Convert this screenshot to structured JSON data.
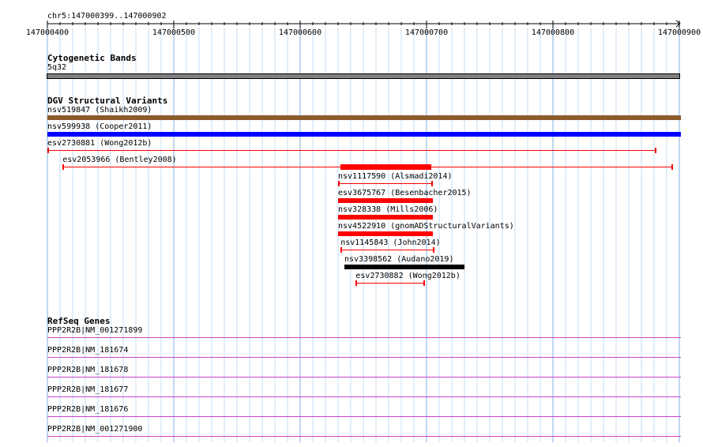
{
  "ruler": {
    "position": "chr5:147000399..147000902",
    "start": 147000400,
    "end": 147000900,
    "tick_labels": [
      "147000400",
      "147000500",
      "147000600",
      "147000700",
      "147000800",
      "147000900"
    ]
  },
  "cytoband": {
    "title": "Cytogenetic Bands",
    "band": "5q32",
    "color": "#808080"
  },
  "dgv": {
    "title": "DGV Structural Variants",
    "variants": [
      {
        "label": "nsv519847 (Shaikh2009)",
        "start": 147000400,
        "end": 147000902,
        "style": "bar",
        "color": "#8b5a2b"
      },
      {
        "label": "nsv599938 (Cooper2011)",
        "start": 147000400,
        "end": 147000902,
        "style": "bar",
        "color": "#0000ff"
      },
      {
        "label": "esv2730881 (Wong2012b)",
        "start": 147000400,
        "end": 147000882,
        "style": "line",
        "color": "#ff0000"
      },
      {
        "label": "esv2053966 (Bentley2008)",
        "start": 147000412,
        "end": 147000895,
        "style": "line-thick",
        "thick_start": 147000632,
        "thick_end": 147000704,
        "color": "#ff0000"
      },
      {
        "label": "nsv1117590 (Alsmadi2014)",
        "start": 147000630,
        "end": 147000705,
        "style": "line",
        "color": "#ff0000"
      },
      {
        "label": "esv3675767 (Besenbacher2015)",
        "start": 147000630,
        "end": 147000705,
        "style": "bar",
        "color": "#ff0000"
      },
      {
        "label": "nsv328338 (Mills2006)",
        "start": 147000630,
        "end": 147000705,
        "style": "bar",
        "color": "#ff0000"
      },
      {
        "label": "nsv4522910 (gnomADStructuralVariants)",
        "start": 147000630,
        "end": 147000705,
        "style": "bar",
        "color": "#ff0000"
      },
      {
        "label": "nsv1145843 (John2014)",
        "start": 147000632,
        "end": 147000706,
        "style": "line",
        "color": "#ff0000"
      },
      {
        "label": "nsv3398562 (Audano2019)",
        "start": 147000635,
        "end": 147000730,
        "style": "bar",
        "color": "#000000"
      },
      {
        "label": "esv2730882 (Wong2012b)",
        "start": 147000644,
        "end": 147000699,
        "style": "line",
        "color": "#ff0000"
      }
    ]
  },
  "refseq": {
    "title": "RefSeq Genes",
    "color": "#cc44cc",
    "genes": [
      {
        "label": "PPP2R2B|NM_001271899"
      },
      {
        "label": "PPP2R2B|NM_181674"
      },
      {
        "label": "PPP2R2B|NM_181678"
      },
      {
        "label": "PPP2R2B|NM_181677"
      },
      {
        "label": "PPP2R2B|NM_181676"
      },
      {
        "label": "PPP2R2B|NM_001271900"
      }
    ]
  }
}
